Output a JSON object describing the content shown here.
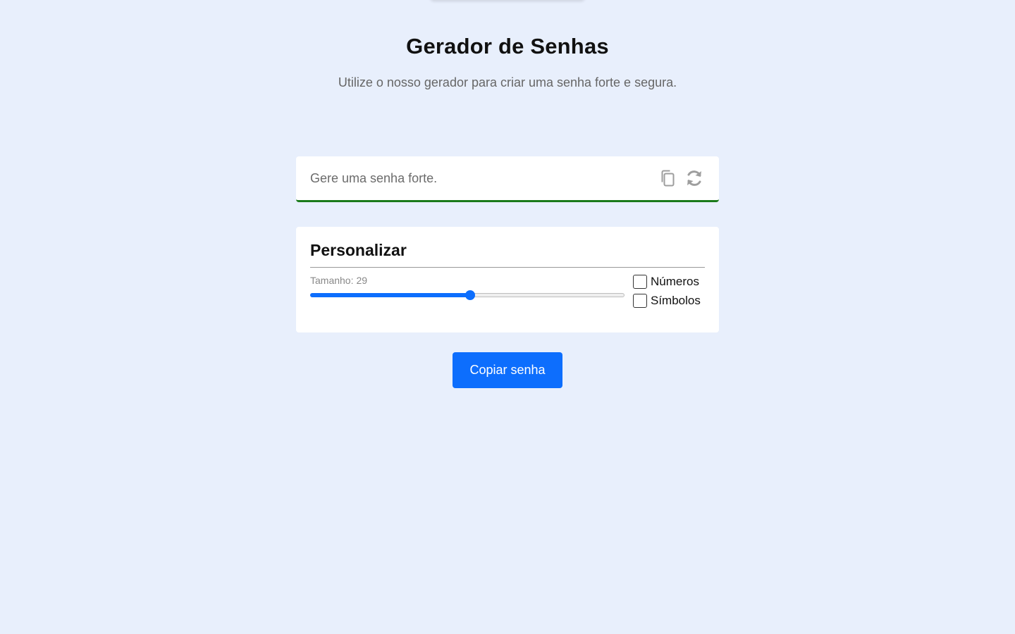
{
  "header": {
    "title": "Gerador de Senhas",
    "subtitle": "Utilize o nosso gerador para criar uma senha forte e segura."
  },
  "password_field": {
    "placeholder": "Gere uma senha forte.",
    "value": "",
    "copy_icon": "copy-icon",
    "refresh_icon": "refresh-icon",
    "strength_color": "#1a7a1a"
  },
  "customize": {
    "title": "Personalizar",
    "length_label": "Tamanho:",
    "length_value": "29",
    "slider_fraction": 0.51,
    "options": [
      {
        "label": "Números",
        "checked": false
      },
      {
        "label": "Símbolos",
        "checked": false
      }
    ]
  },
  "actions": {
    "copy_button_label": "Copiar senha"
  },
  "colors": {
    "accent": "#0d6efd",
    "background": "#e8effc"
  }
}
